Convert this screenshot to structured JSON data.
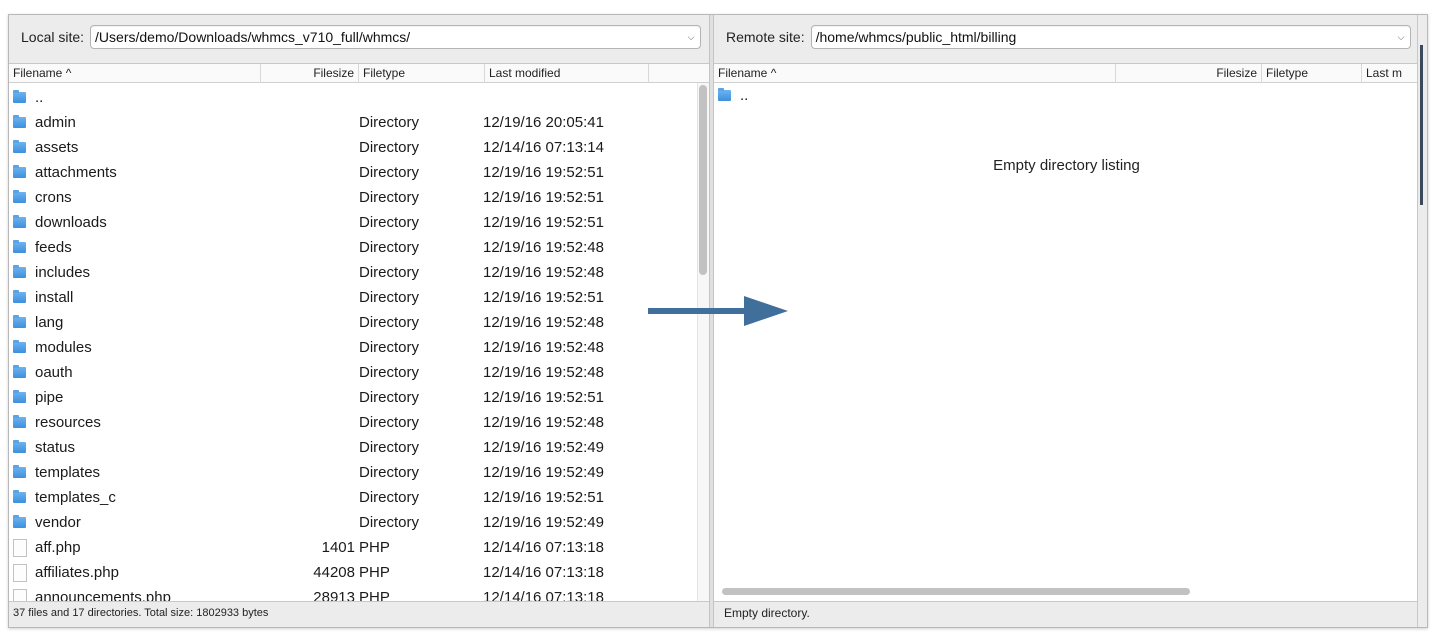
{
  "local": {
    "site_label": "Local site:",
    "path": "/Users/demo/Downloads/whmcs_v710_full/whmcs/",
    "columns": {
      "filename": "Filename",
      "filesize": "Filesize",
      "filetype": "Filetype",
      "modified": "Last modified"
    },
    "rows": [
      {
        "name": "..",
        "size": "",
        "type": "",
        "modified": "",
        "icon": "folder-icon"
      },
      {
        "name": "admin",
        "size": "",
        "type": "Directory",
        "modified": "12/19/16 20:05:41",
        "icon": "folder-icon"
      },
      {
        "name": "assets",
        "size": "",
        "type": "Directory",
        "modified": "12/14/16 07:13:14",
        "icon": "folder-icon"
      },
      {
        "name": "attachments",
        "size": "",
        "type": "Directory",
        "modified": "12/19/16 19:52:51",
        "icon": "folder-icon"
      },
      {
        "name": "crons",
        "size": "",
        "type": "Directory",
        "modified": "12/19/16 19:52:51",
        "icon": "folder-icon"
      },
      {
        "name": "downloads",
        "size": "",
        "type": "Directory",
        "modified": "12/19/16 19:52:51",
        "icon": "folder-icon"
      },
      {
        "name": "feeds",
        "size": "",
        "type": "Directory",
        "modified": "12/19/16 19:52:48",
        "icon": "folder-icon"
      },
      {
        "name": "includes",
        "size": "",
        "type": "Directory",
        "modified": "12/19/16 19:52:48",
        "icon": "folder-icon"
      },
      {
        "name": "install",
        "size": "",
        "type": "Directory",
        "modified": "12/19/16 19:52:51",
        "icon": "folder-icon"
      },
      {
        "name": "lang",
        "size": "",
        "type": "Directory",
        "modified": "12/19/16 19:52:48",
        "icon": "folder-icon"
      },
      {
        "name": "modules",
        "size": "",
        "type": "Directory",
        "modified": "12/19/16 19:52:48",
        "icon": "folder-icon"
      },
      {
        "name": "oauth",
        "size": "",
        "type": "Directory",
        "modified": "12/19/16 19:52:48",
        "icon": "folder-icon"
      },
      {
        "name": "pipe",
        "size": "",
        "type": "Directory",
        "modified": "12/19/16 19:52:51",
        "icon": "folder-icon"
      },
      {
        "name": "resources",
        "size": "",
        "type": "Directory",
        "modified": "12/19/16 19:52:48",
        "icon": "folder-icon"
      },
      {
        "name": "status",
        "size": "",
        "type": "Directory",
        "modified": "12/19/16 19:52:49",
        "icon": "folder-icon"
      },
      {
        "name": "templates",
        "size": "",
        "type": "Directory",
        "modified": "12/19/16 19:52:49",
        "icon": "folder-icon"
      },
      {
        "name": "templates_c",
        "size": "",
        "type": "Directory",
        "modified": "12/19/16 19:52:51",
        "icon": "folder-icon"
      },
      {
        "name": "vendor",
        "size": "",
        "type": "Directory",
        "modified": "12/19/16 19:52:49",
        "icon": "folder-icon"
      },
      {
        "name": "aff.php",
        "size": "1401",
        "type": "PHP",
        "modified": "12/14/16 07:13:18",
        "icon": "file-icon"
      },
      {
        "name": "affiliates.php",
        "size": "44208",
        "type": "PHP",
        "modified": "12/14/16 07:13:18",
        "icon": "file-icon"
      },
      {
        "name": "announcements.php",
        "size": "28913",
        "type": "PHP",
        "modified": "12/14/16 07:13:18",
        "icon": "file-icon"
      }
    ],
    "status": "37 files and 17 directories. Total size: 1802933 bytes"
  },
  "remote": {
    "site_label": "Remote site:",
    "path": "/home/whmcs/public_html/billing",
    "columns": {
      "filename": "Filename",
      "filesize": "Filesize",
      "filetype": "Filetype",
      "modified": "Last m"
    },
    "rows": [
      {
        "name": "..",
        "icon": "folder-icon"
      }
    ],
    "empty_message": "Empty directory listing",
    "status": "Empty directory."
  },
  "colors": {
    "arrow": "#3f6f9a",
    "folder": "#4a9ae6"
  }
}
